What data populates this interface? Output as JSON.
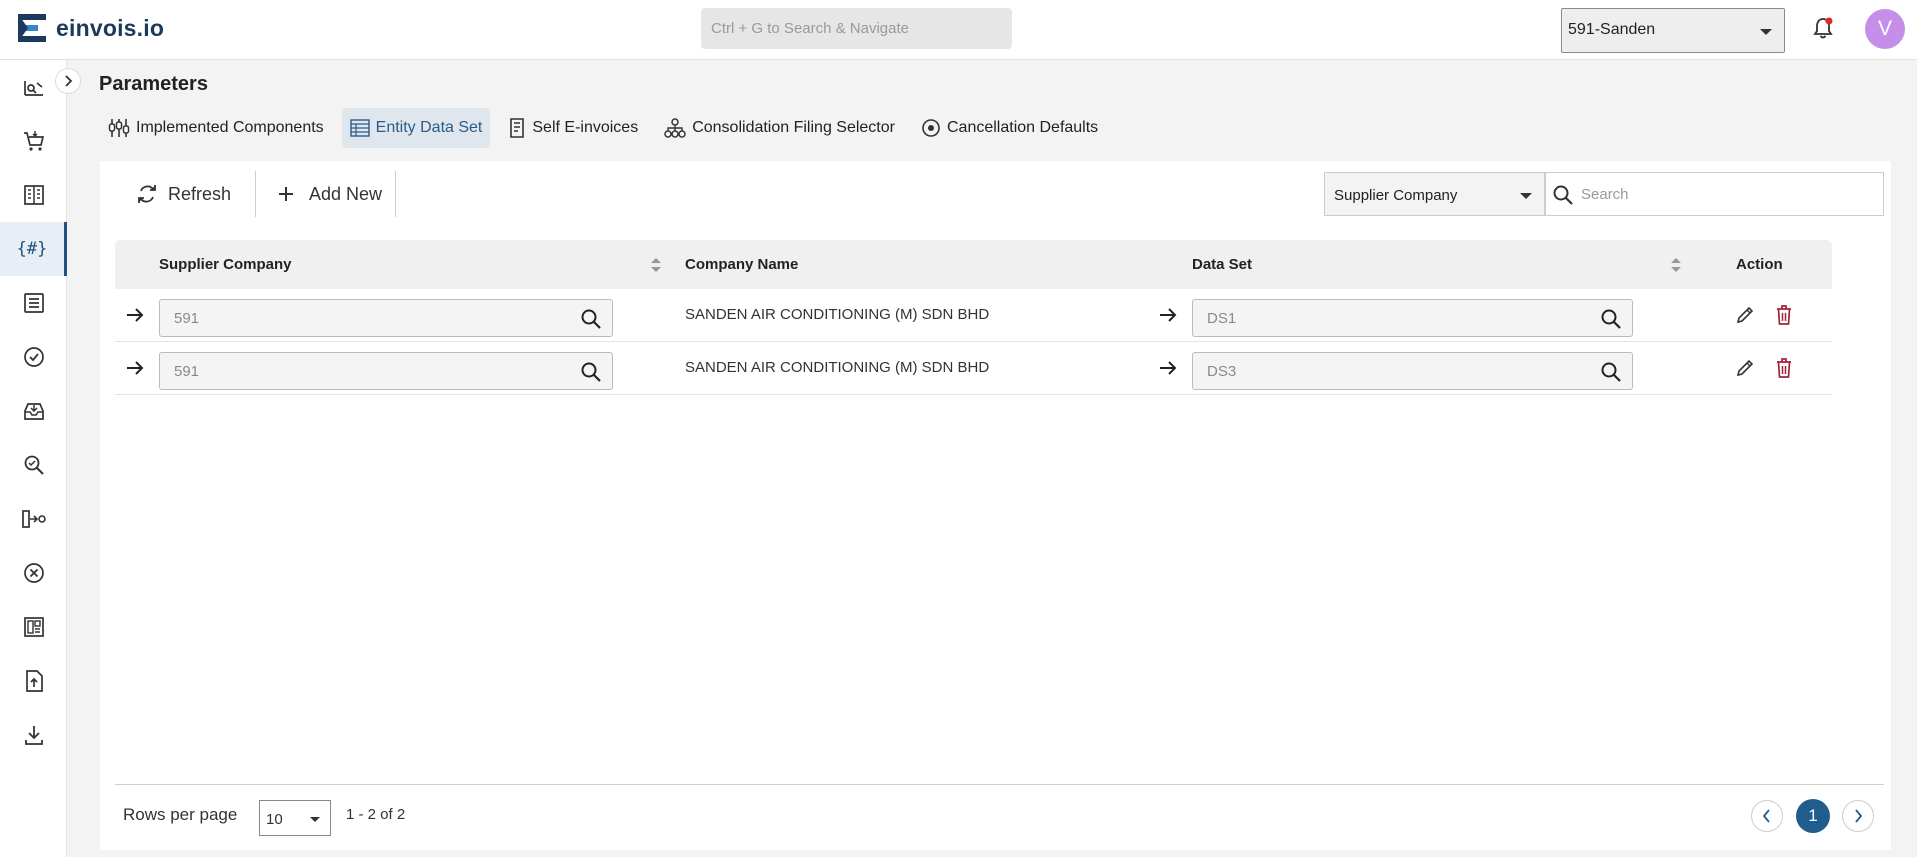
{
  "app": {
    "brand": "einvois.io"
  },
  "header": {
    "search_placeholder": "Ctrl + G to Search & Navigate",
    "company_selected": "591-Sanden",
    "avatar_initial": "V"
  },
  "sidebar": {
    "items": [
      {
        "icon": "analytics-icon"
      },
      {
        "icon": "cart-icon"
      },
      {
        "icon": "receipt-icon"
      },
      {
        "icon": "parameters-icon",
        "label": "{#}",
        "active": true
      },
      {
        "icon": "list-icon"
      },
      {
        "icon": "check-circle-icon"
      },
      {
        "icon": "inbox-icon"
      },
      {
        "icon": "search-doc-icon"
      },
      {
        "icon": "flow-icon"
      },
      {
        "icon": "cancel-icon"
      },
      {
        "icon": "dashboard-icon"
      },
      {
        "icon": "upload-file-icon"
      },
      {
        "icon": "download-icon"
      }
    ]
  },
  "page": {
    "title": "Parameters",
    "tabs": [
      {
        "label": "Implemented Components",
        "icon": "components-icon"
      },
      {
        "label": "Entity Data Set",
        "icon": "table-icon",
        "active": true
      },
      {
        "label": "Self E-invoices",
        "icon": "document-icon"
      },
      {
        "label": "Consolidation Filing Selector",
        "icon": "hierarchy-icon"
      },
      {
        "label": "Cancellation Defaults",
        "icon": "target-icon"
      }
    ]
  },
  "toolbar": {
    "refresh_label": "Refresh",
    "add_new_label": "Add New",
    "filter_field": "Supplier Company",
    "search_placeholder": "Search"
  },
  "table": {
    "columns": [
      "Supplier Company",
      "Company Name",
      "Data Set",
      "Action"
    ],
    "rows": [
      {
        "supplier_company": "591",
        "company_name": "SANDEN AIR CONDITIONING (M) SDN BHD",
        "data_set": "DS1"
      },
      {
        "supplier_company": "591",
        "company_name": "SANDEN AIR CONDITIONING (M) SDN BHD",
        "data_set": "DS3"
      }
    ]
  },
  "pagination": {
    "rows_per_page_label": "Rows per page",
    "rows_per_page": "10",
    "range": "1 - 2 of 2",
    "current_page": "1"
  },
  "colors": {
    "brand": "#1d3a5c",
    "accent": "#1f5e8c",
    "delete": "#a0243a",
    "avatar": "#c58ee8"
  }
}
